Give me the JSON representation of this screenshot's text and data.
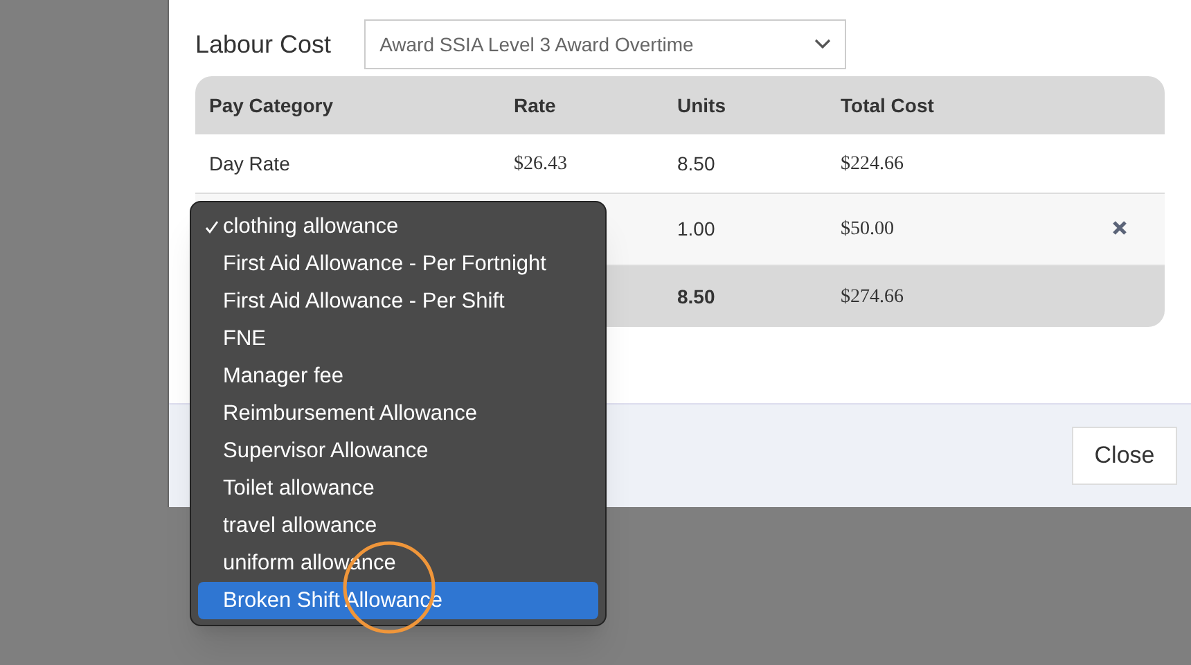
{
  "labour_cost": {
    "label": "Labour Cost",
    "select_value": "Award SSIA Level 3 Award Overtime"
  },
  "table": {
    "columns": [
      "Pay Category",
      "Rate",
      "Units",
      "Total Cost"
    ],
    "rows": [
      {
        "pay_category": "Day Rate",
        "rate": "$26.43",
        "units": "8.50",
        "total_cost": "$224.66",
        "removable": false
      },
      {
        "units": "1.00",
        "total_cost": "$50.00",
        "removable": true
      }
    ],
    "total": {
      "units": "8.50",
      "total_cost": "$274.66"
    }
  },
  "menu": {
    "items": [
      {
        "label": "clothing allowance",
        "checked": true,
        "selected": false
      },
      {
        "label": "First Aid Allowance - Per Fortnight",
        "checked": false,
        "selected": false
      },
      {
        "label": "First Aid Allowance - Per Shift",
        "checked": false,
        "selected": false
      },
      {
        "label": "FNE",
        "checked": false,
        "selected": false
      },
      {
        "label": "Manager fee",
        "checked": false,
        "selected": false
      },
      {
        "label": "Reimbursement Allowance",
        "checked": false,
        "selected": false
      },
      {
        "label": "Supervisor Allowance",
        "checked": false,
        "selected": false
      },
      {
        "label": "Toilet allowance",
        "checked": false,
        "selected": false
      },
      {
        "label": "travel allowance",
        "checked": false,
        "selected": false
      },
      {
        "label": "uniform allowance",
        "checked": false,
        "selected": false
      },
      {
        "label": "Broken Shift Allowance",
        "checked": false,
        "selected": true
      }
    ]
  },
  "footer": {
    "close_button": "Close"
  }
}
